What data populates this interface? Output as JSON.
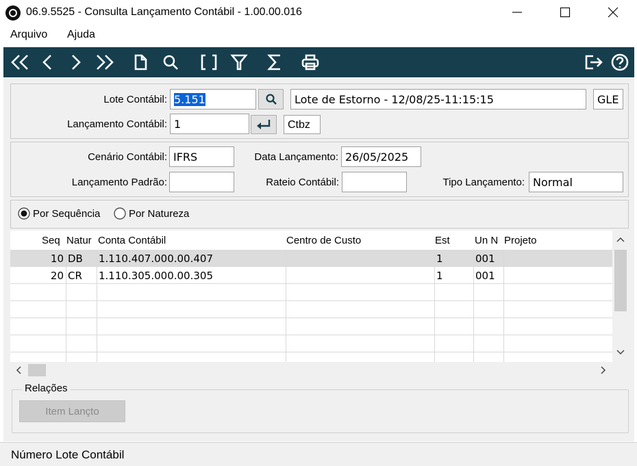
{
  "window": {
    "title": "06.9.5525 - Consulta Lançamento Contábil - 1.00.00.016",
    "minimize_icon": "minimize-icon",
    "maximize_icon": "maximize-icon",
    "close_icon": "close-icon"
  },
  "menu": {
    "items": [
      "Arquivo",
      "Ajuda"
    ]
  },
  "toolbar": {
    "accent": "#163e4d",
    "icons": [
      "first-record-icon",
      "previous-record-icon",
      "next-record-icon",
      "last-record-icon",
      "new-document-icon",
      "search-icon",
      "brackets-icon",
      "filter-icon",
      "sum-icon",
      "print-icon",
      "exit-icon",
      "help-icon"
    ]
  },
  "header": {
    "lote_label": "Lote Contábil:",
    "lote_value": "5.151",
    "lote_desc": "Lote de Estorno - 12/08/25-11:15:15",
    "lote_code": "GLE",
    "lancamento_label": "Lançamento Contábil:",
    "lancamento_value": "1",
    "ctbz_label": "Ctbz"
  },
  "details": {
    "cenario_label": "Cenário Contábil:",
    "cenario_value": "IFRS",
    "data_label": "Data Lançamento:",
    "data_value": "26/05/2025",
    "padrao_label": "Lançamento Padrão:",
    "padrao_value": "",
    "rateio_label": "Rateio Contábil:",
    "rateio_value": "",
    "tipo_label": "Tipo Lançamento:",
    "tipo_value": "Normal"
  },
  "sort": {
    "options": [
      "Por Sequência",
      "Por Natureza"
    ],
    "selected": "Por Sequência"
  },
  "grid": {
    "columns": [
      "Seq",
      "Natur",
      "Conta Contábil",
      "Centro de Custo",
      "Est",
      "Un N",
      "Projeto"
    ],
    "rows": [
      [
        "10",
        "DB",
        "1.110.407.000.00.407",
        "",
        "1",
        "001",
        ""
      ],
      [
        "20",
        "CR",
        "1.110.305.000.00.305",
        "",
        "1",
        "001",
        ""
      ]
    ]
  },
  "relacoes": {
    "title": "Relações",
    "button": "Item Lançto"
  },
  "status": {
    "text": "Número Lote Contábil"
  }
}
